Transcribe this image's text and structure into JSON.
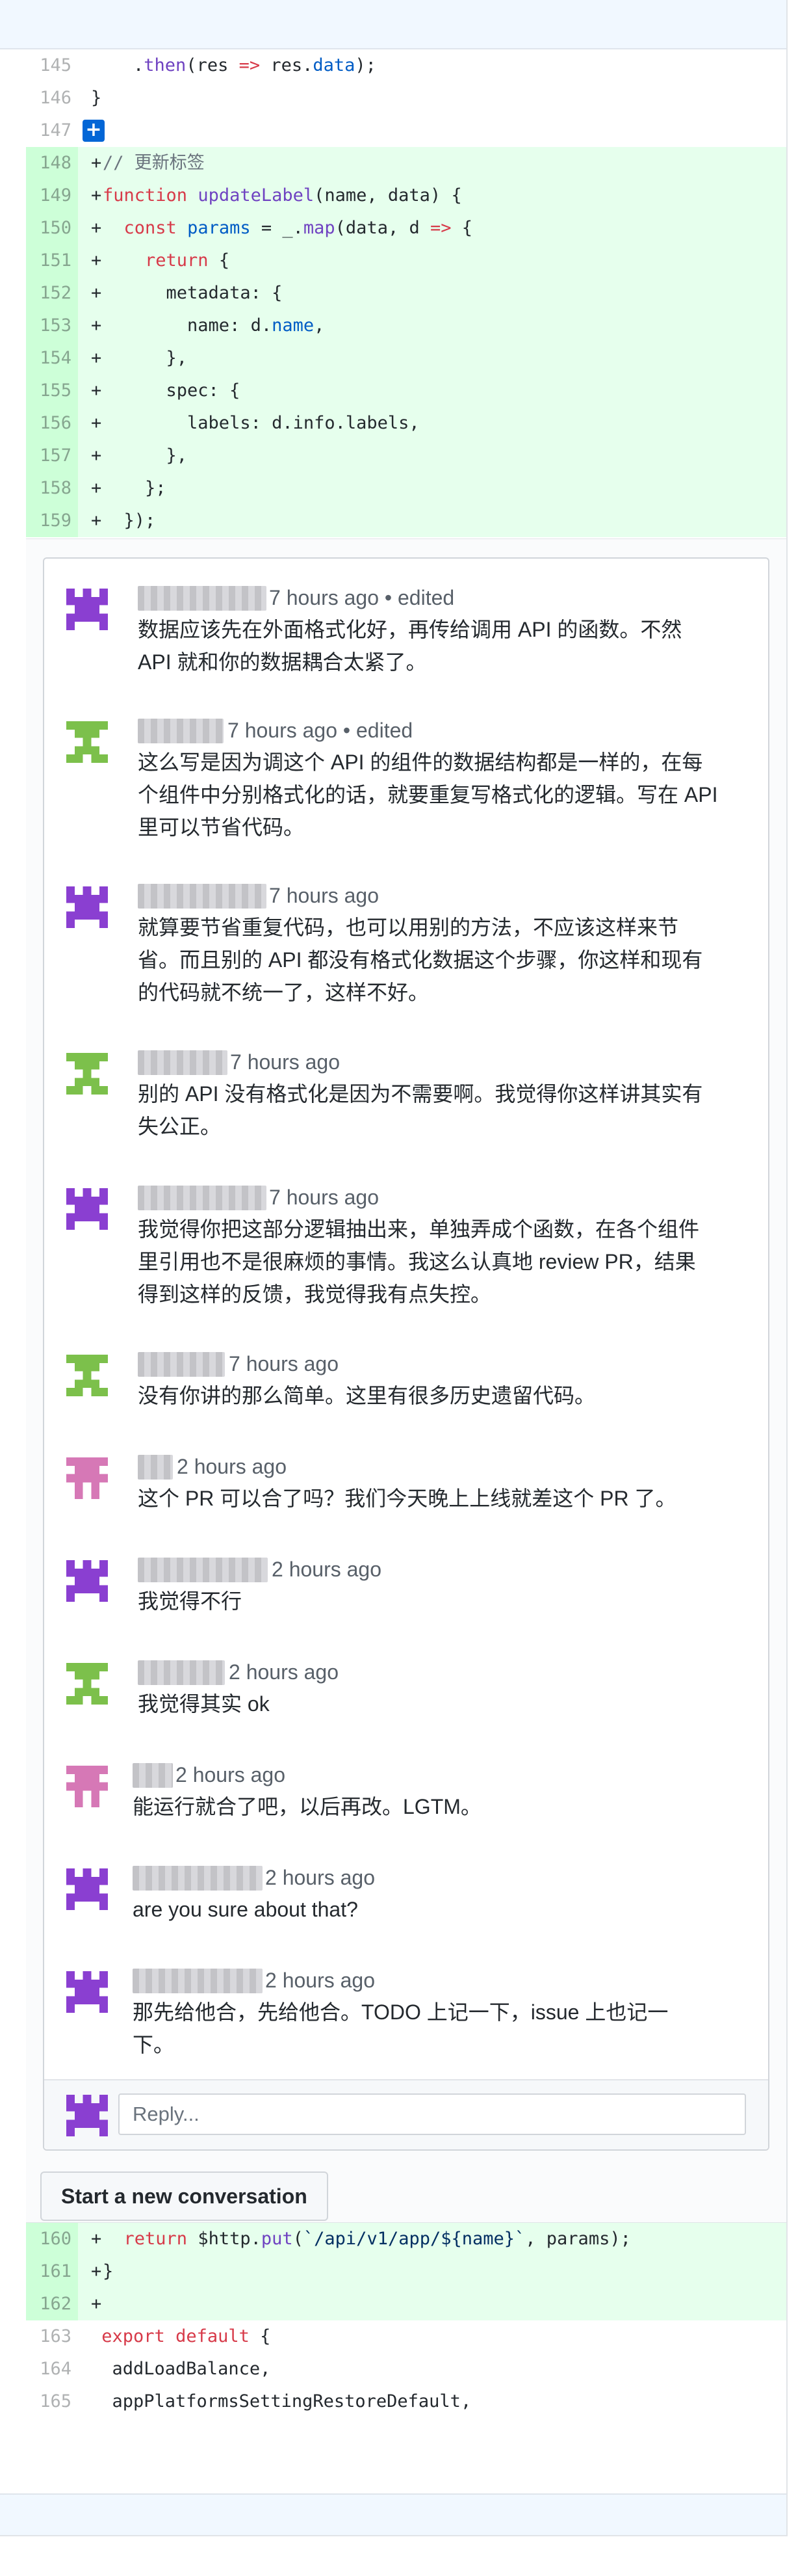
{
  "code_top": [
    {
      "num": "145",
      "text": "    .then(res => res.data);",
      "added": false
    },
    {
      "num": "146",
      "text": "}",
      "added": false
    },
    {
      "num": "147",
      "text": "",
      "added": false
    },
    {
      "num": "148",
      "text": "// 更新标签",
      "added": true
    },
    {
      "num": "149",
      "text": "function updateLabel(name, data) {",
      "added": true
    },
    {
      "num": "150",
      "text": "  const params = _.map(data, d => {",
      "added": true
    },
    {
      "num": "151",
      "text": "    return {",
      "added": true
    },
    {
      "num": "152",
      "text": "      metadata: {",
      "added": true
    },
    {
      "num": "153",
      "text": "        name: d.name,",
      "added": true
    },
    {
      "num": "154",
      "text": "      },",
      "added": true
    },
    {
      "num": "155",
      "text": "      spec: {",
      "added": true
    },
    {
      "num": "156",
      "text": "        labels: d.info.labels,",
      "added": true
    },
    {
      "num": "157",
      "text": "      },",
      "added": true
    },
    {
      "num": "158",
      "text": "    };",
      "added": true
    },
    {
      "num": "159",
      "text": "  });",
      "added": true
    }
  ],
  "add_comment_symbol": "+",
  "comments": [
    {
      "meta": "7 hours ago • edited",
      "lines": [
        "数据应该先在外面格式化好，再传给调用 API 的函数。不然",
        "API 就和你的数据耦合太紧了。"
      ],
      "avatar": "purple"
    },
    {
      "meta": "7 hours ago • edited",
      "lines": [
        "这么写是因为调这个 API 的组件的数据结构都是一样的，在每",
        "个组件中分别格式化的话，就要重复写格式化的逻辑。写在 API",
        "里可以节省代码。"
      ],
      "avatar": "green"
    },
    {
      "meta": "7 hours ago",
      "lines": [
        "就算要节省重复代码，也可以用别的方法，不应该这样来节",
        "省。而且别的 API 都没有格式化数据这个步骤，你这样和现有",
        "的代码就不统一了，这样不好。"
      ],
      "avatar": "purple"
    },
    {
      "meta": "7 hours ago",
      "lines": [
        "别的 API 没有格式化是因为不需要啊。我觉得你这样讲其实有",
        "失公正。"
      ],
      "avatar": "green"
    },
    {
      "meta": "7 hours ago",
      "lines": [
        "我觉得你把这部分逻辑抽出来，单独弄成个函数，在各个组件",
        "里引用也不是很麻烦的事情。我这么认真地 review PR，结果",
        "得到这样的反馈，我觉得我有点失控。"
      ],
      "avatar": "purple"
    },
    {
      "meta": "7 hours ago",
      "lines": [
        "没有你讲的那么简单。这里有很多历史遗留代码。"
      ],
      "avatar": "green"
    },
    {
      "meta": "2 hours ago",
      "lines": [
        "这个 PR 可以合了吗？我们今天晚上上线就差这个 PR 了。"
      ],
      "avatar": "pink"
    },
    {
      "meta": "2 hours ago",
      "lines": [
        "我觉得不行"
      ],
      "avatar": "purple"
    },
    {
      "meta": "2 hours ago",
      "lines": [
        "我觉得其实 ok"
      ],
      "avatar": "green"
    },
    {
      "meta": "2 hours ago",
      "lines": [
        "能运行就合了吧，以后再改。LGTM。"
      ],
      "avatar": "pink"
    },
    {
      "meta": "2 hours ago",
      "lines": [
        "are you sure about that?"
      ],
      "avatar": "purple"
    },
    {
      "meta": "2 hours ago",
      "lines": [
        "那先给他合，先给他合。TODO 上记一下，issue 上也记一",
        "下。"
      ],
      "avatar": "purple"
    }
  ],
  "reply": {
    "placeholder": "Reply..."
  },
  "new_conversation_label": "Start a new conversation",
  "code_bottom": [
    {
      "num": "160",
      "text": "  return $http.put(`/api/v1/app/${name}`, params);",
      "added": true
    },
    {
      "num": "161",
      "text": "}",
      "added": true
    },
    {
      "num": "162",
      "text": "",
      "added": true
    },
    {
      "num": "163",
      "text": "export default {",
      "added": false
    },
    {
      "num": "164",
      "text": "  addLoadBalance,",
      "added": false
    },
    {
      "num": "165",
      "text": "  appPlatformsSettingRestoreDefault,",
      "added": false
    }
  ],
  "colors": {
    "added_bg": "#e6ffed",
    "added_num_bg": "#cdffd8",
    "link_blue": "#0366d6",
    "avatar_purple": "#8a3fd1",
    "avatar_green": "#7cc04b",
    "avatar_pink": "#d678b6"
  },
  "icons": {
    "avatar_purple": "identicon",
    "avatar_green": "identicon",
    "avatar_pink": "identicon",
    "add_comment": "plus-icon"
  }
}
